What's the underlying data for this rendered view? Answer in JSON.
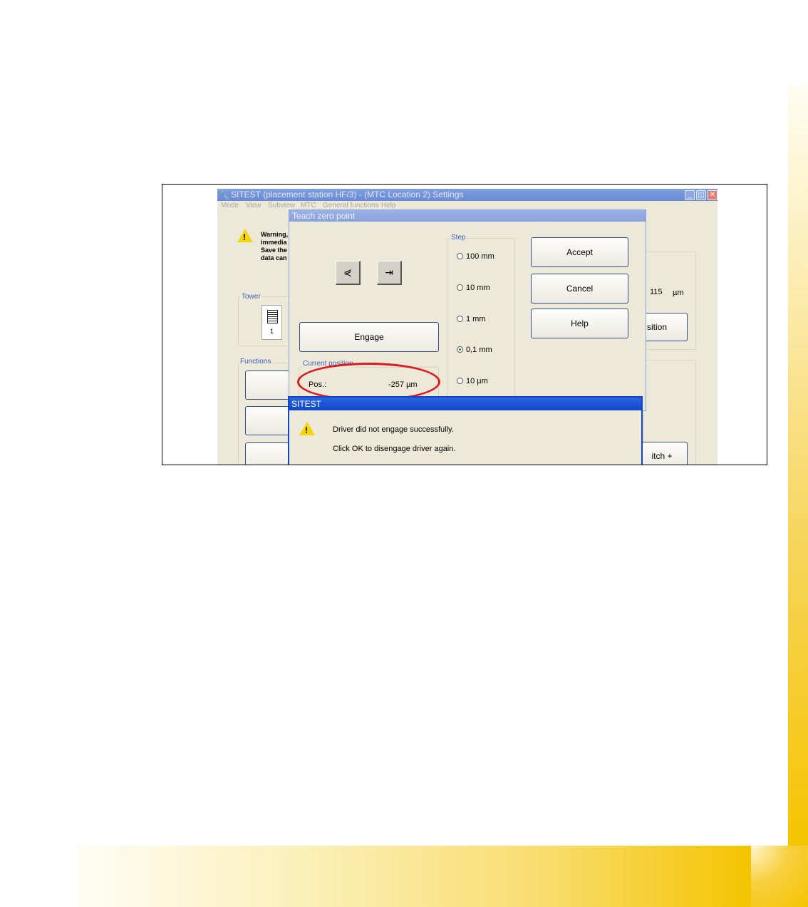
{
  "window": {
    "title": "SITEST (placement station HF/3) - (MTC Location 2) Settings",
    "minimize_glyph": "_",
    "restore_glyph": "◫",
    "close_glyph": "✕"
  },
  "menu": [
    "Mode",
    "View",
    "Subview",
    "MTC",
    "General functions",
    "Help"
  ],
  "background": {
    "warning_lines": [
      "Warning,",
      "immedia",
      "Save the",
      "data can"
    ],
    "tower_label": "Tower",
    "tower_number": "1",
    "value_text": "115",
    "value_unit": "µm",
    "position_button_partial": "sition",
    "functions_label": "Functions",
    "switch_button_partial": "itch +"
  },
  "teach_dialog": {
    "title": "Teach zero point",
    "arrow_left_glyph": "⋞",
    "arrow_right_glyph": "⇥",
    "engage_label": "Engage",
    "current_position_label": "Current position",
    "pos_label": "Pos.:",
    "pos_value": "-257 µm",
    "step_label": "Step",
    "steps": [
      {
        "label": "100 mm",
        "selected": false
      },
      {
        "label": "10 mm",
        "selected": false
      },
      {
        "label": "1 mm",
        "selected": false
      },
      {
        "label": "0,1 mm",
        "selected": true
      },
      {
        "label": "10 µm",
        "selected": false
      }
    ],
    "accept_label": "Accept",
    "cancel_label": "Cancel",
    "help_label": "Help"
  },
  "message_box": {
    "title": "SITEST",
    "line1": "Driver did not engage successfully.",
    "line2": "Click OK to disengage driver again."
  },
  "colors": {
    "title_active": "#1048c8",
    "title_inactive": "#8aa3dd",
    "dialog_bg": "#ece9d8",
    "highlight": "#e0191f",
    "accent_band": "#f5c400"
  }
}
